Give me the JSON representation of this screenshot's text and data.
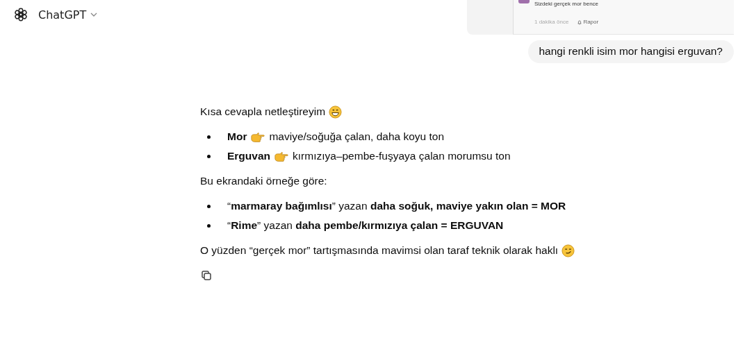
{
  "header": {
    "title": "ChatGPT"
  },
  "user_message": {
    "attachment": {
      "comment": "Sizdeki gerçek mor bence",
      "time": "1 dakika önce",
      "report": "Rapor"
    },
    "text": "hangi renkli isim mor hangisi erguvan?"
  },
  "assistant_message": {
    "blocks": [
      {
        "kind": "paragraph",
        "parts": [
          {
            "kind": "text",
            "text": "Kısa cevapla netleştireyim"
          },
          {
            "kind": "grinning-face"
          }
        ]
      },
      {
        "kind": "list",
        "items": [
          {
            "kind": "definition",
            "term": "Mor",
            "text": "maviye/soğuğa çalan, daha koyu ton"
          },
          {
            "kind": "definition",
            "term": "Erguvan",
            "text": "kırmızıya–pembe-fuşyaya çalan morumsu ton"
          }
        ]
      },
      {
        "kind": "paragraph",
        "parts": [
          {
            "kind": "text",
            "text": "Bu ekrandaki örneğe göre:"
          }
        ]
      },
      {
        "kind": "list",
        "items": [
          {
            "kind": "rich",
            "text": "“**marmaray bağımlısı**” yazan **daha soğuk, maviye yakın olan = MOR**"
          },
          {
            "kind": "rich",
            "text": "“**Rime**” yazan **daha pembe/kırmızıya çalan = ERGUVAN**"
          }
        ]
      },
      {
        "kind": "paragraph",
        "parts": [
          {
            "kind": "text",
            "text": "O yüzden “gerçek mor” tartışmasında mavimsi olan taraf teknik olarak haklı"
          },
          {
            "kind": "smirking-face"
          }
        ]
      }
    ]
  }
}
